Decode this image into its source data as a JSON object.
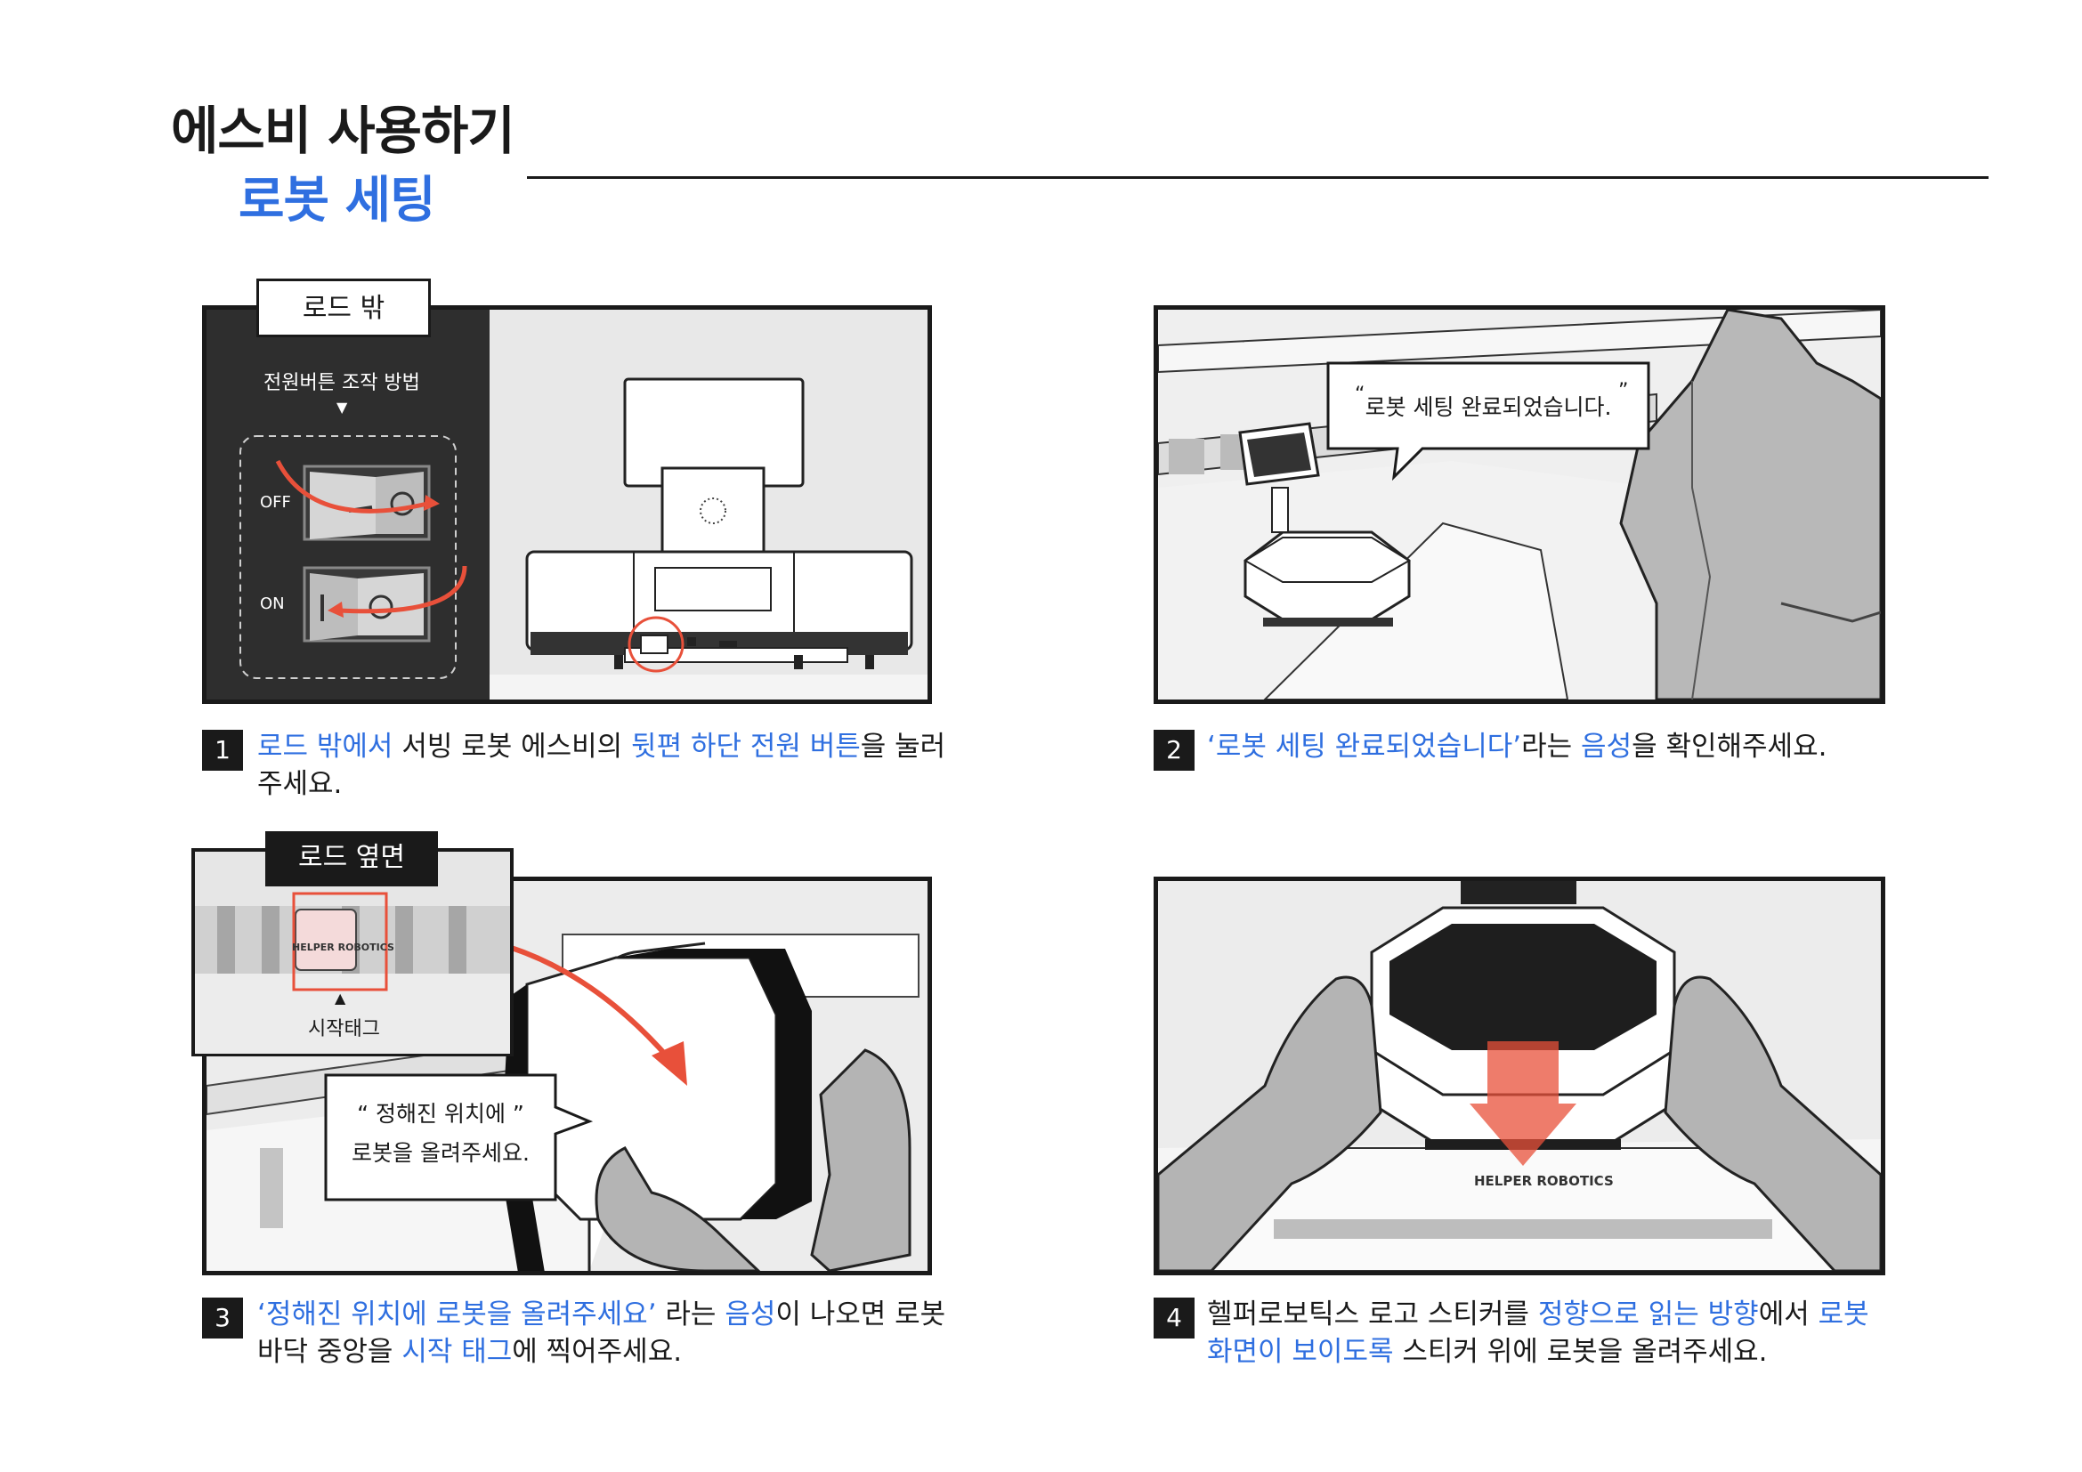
{
  "header": {
    "title": "에스비 사용하기",
    "subtitle": "로봇 세팅"
  },
  "panel1": {
    "tag": "로드 밖",
    "guide_title": "전원버튼 조작 방법",
    "off_label": "OFF",
    "on_label": "ON"
  },
  "panel2": {
    "speech": "로봇 세팅 완료되었습니다.",
    "open_quote": "“",
    "close_quote": "”"
  },
  "panel3": {
    "tag": "로드 옆면",
    "logo_text": "HELPER ROBOTICS",
    "start_tag_label": "시작태그",
    "speech_line1": "“  정해진 위치에  ”",
    "speech_line2": "로봇을 올려주세요."
  },
  "panel4": {
    "logo_text": "HELPER ROBOTICS"
  },
  "captions": {
    "c1": {
      "num": "1",
      "a": "로드 밖에서",
      "b": " 서빙 로봇 에스비의 ",
      "c": "뒷편 하단 전원 버튼",
      "d": "을 눌러",
      "e": "주세요."
    },
    "c2": {
      "num": "2",
      "a": "‘로봇 세팅 완료되었습니다’",
      "b": "라는 ",
      "c": "음성",
      "d": "을 확인해주세요."
    },
    "c3": {
      "num": "3",
      "a": "‘정해진 위치에 로봇을 올려주세요’",
      "b": " 라는 ",
      "c": "음성",
      "d": "이 나오면 로봇",
      "e": "바닥 중앙을 ",
      "f": "시작 태그",
      "g": "에 찍어주세요."
    },
    "c4": {
      "num": "4",
      "a": "헬퍼로보틱스 로고 스티커를 ",
      "b": "정향으로 읽는 방향",
      "c": "에서 ",
      "d": "로봇",
      "e": "화면이 보이도록",
      "f": " 스티커 위에 로봇을 올려주세요."
    }
  },
  "colors": {
    "accent": "#2f6fe0",
    "arrow": "#e8503a",
    "dark": "#2c2c2c"
  }
}
